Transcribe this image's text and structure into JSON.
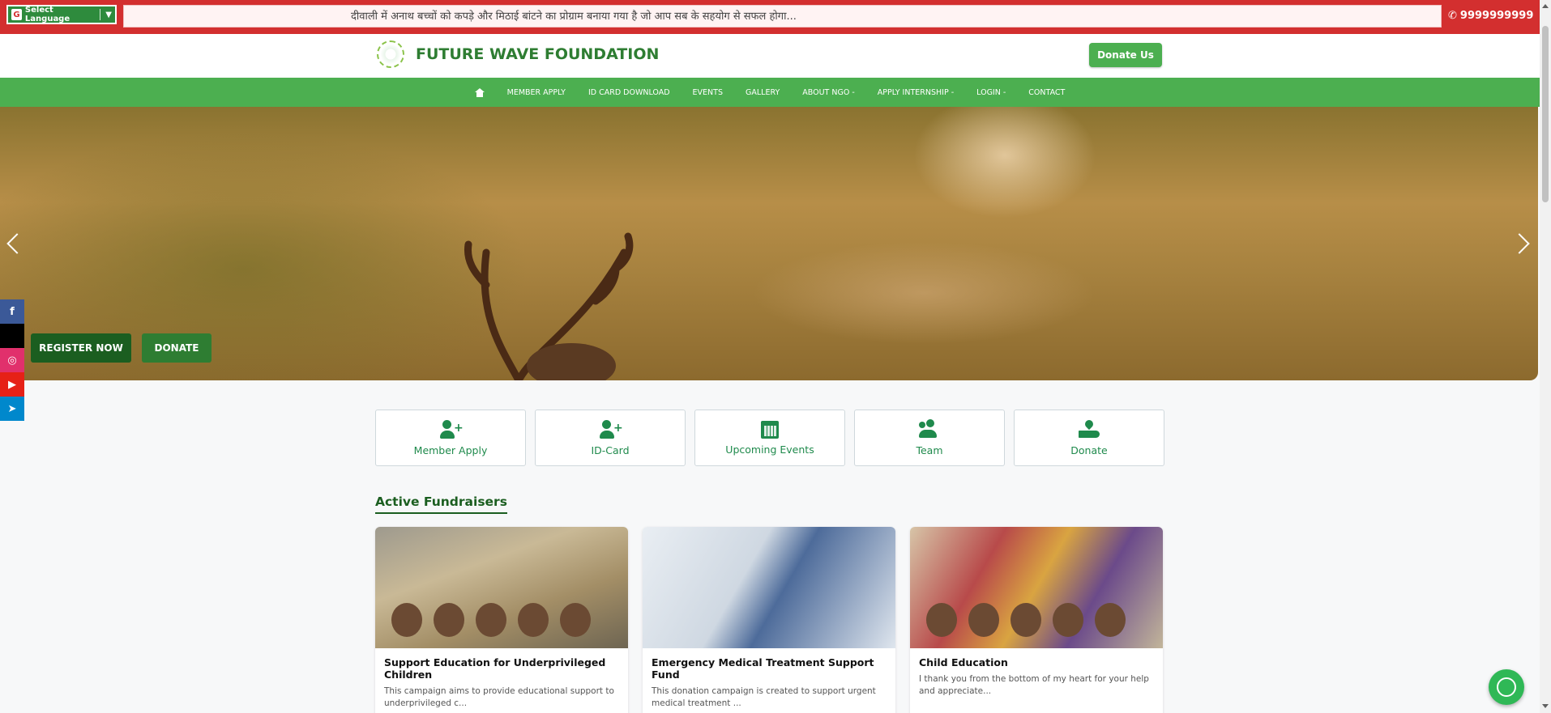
{
  "topbar": {
    "language_label": "Select Language",
    "language_icon": "google-icon",
    "ticker_text": "दीवाली में अनाथ बच्चों को कपड़े और मिठाई बांटने का प्रोग्राम बनाया गया है जो आप सब के सहयोग से सफल होगा...",
    "phone": "9999999999"
  },
  "header": {
    "brand": "FUTURE WAVE FOUNDATION",
    "donate_button": "Donate Us"
  },
  "nav": {
    "items": [
      "MEMBER APPLY",
      "ID CARD DOWNLOAD",
      "EVENTS",
      "GALLERY",
      "ABOUT NGO -",
      "APPLY INTERNSHIP -",
      "LOGIN -",
      "CONTACT"
    ]
  },
  "hero": {
    "register_button": "REGISTER NOW",
    "donate_button": "DONATE"
  },
  "social": {
    "items": [
      {
        "name": "facebook",
        "glyph": "f",
        "color": "#3b5998"
      },
      {
        "name": "x",
        "glyph": "",
        "color": "#000000"
      },
      {
        "name": "instagram",
        "glyph": "◎",
        "color": "#e1306c"
      },
      {
        "name": "youtube",
        "glyph": "▶",
        "color": "#e62117"
      },
      {
        "name": "telegram",
        "glyph": "➤",
        "color": "#0088cc"
      }
    ]
  },
  "quick_links": [
    {
      "label": "Member Apply",
      "icon": "user-plus-icon"
    },
    {
      "label": "ID-Card",
      "icon": "user-plus-icon"
    },
    {
      "label": "Upcoming Events",
      "icon": "calendar-icon"
    },
    {
      "label": "Team",
      "icon": "team-icon"
    },
    {
      "label": "Donate",
      "icon": "donate-hand-icon"
    }
  ],
  "fundraisers": {
    "title": "Active Fundraisers",
    "cards": [
      {
        "title": "Support Education for Underprivileged Children",
        "desc": "This campaign aims to provide educational support to underprivileged c..."
      },
      {
        "title": "Emergency Medical Treatment Support Fund",
        "desc": "This donation campaign is created to support urgent medical treatment ..."
      },
      {
        "title": "Child Education",
        "desc": "I thank you from the bottom of my heart for your help and appreciate..."
      }
    ]
  },
  "colors": {
    "topbar": "#d32f2f",
    "brand_green": "#2e7d32",
    "nav_green": "#4caf50",
    "accent_green": "#1f8a4c"
  }
}
